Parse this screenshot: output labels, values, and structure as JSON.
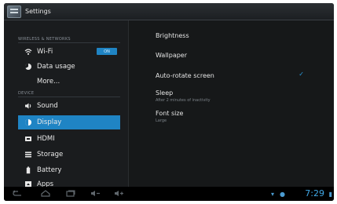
{
  "app": {
    "title": "Settings",
    "icon": "settings-app-icon"
  },
  "sidebar": {
    "sections": [
      {
        "label": "WIRELESS & NETWORKS"
      },
      {
        "label": "DEVICE"
      }
    ],
    "items": [
      {
        "label": "Wi-Fi",
        "icon": "wifi-icon",
        "toggle": "ON"
      },
      {
        "label": "Data usage",
        "icon": "data-usage-icon"
      },
      {
        "label": "More..."
      },
      {
        "label": "Sound",
        "icon": "sound-icon"
      },
      {
        "label": "Display",
        "icon": "display-icon",
        "selected": true
      },
      {
        "label": "HDMI",
        "icon": "hdmi-icon"
      },
      {
        "label": "Storage",
        "icon": "storage-icon"
      },
      {
        "label": "Battery",
        "icon": "battery-icon"
      },
      {
        "label": "Apps",
        "icon": "apps-icon"
      }
    ]
  },
  "display_settings": {
    "items": [
      {
        "title": "Brightness"
      },
      {
        "title": "Wallpaper"
      },
      {
        "title": "Auto-rotate screen",
        "checked": true
      },
      {
        "title": "Sleep",
        "summary": "After 2 minutes of inactivity"
      },
      {
        "title": "Font size",
        "summary": "Large"
      }
    ]
  },
  "navbar": {
    "time": "7:29"
  },
  "colors": {
    "accent": "#1f84c4",
    "clock": "#41a8e6"
  }
}
